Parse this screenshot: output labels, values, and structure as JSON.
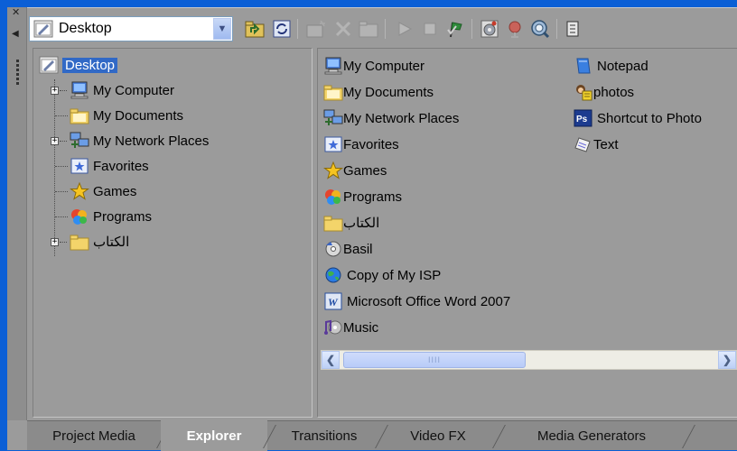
{
  "location": {
    "value": "Desktop"
  },
  "toolbar": {
    "buttons": [
      "up-folder",
      "refresh",
      "new-folder",
      "delete",
      "folder",
      "play",
      "stop",
      "auto-preview",
      "media-info",
      "record",
      "views",
      "more"
    ]
  },
  "tree": {
    "root": "Desktop",
    "items": [
      "My Computer",
      "My Documents",
      "My Network Places",
      "Favorites",
      "Games",
      "Programs",
      "الكتاب"
    ]
  },
  "list": {
    "col1": [
      "My Computer",
      "My Documents",
      "My Network Places",
      "Favorites",
      "Games",
      "Programs",
      "الكتاب",
      "Basil",
      "Copy of My ISP",
      "Microsoft Office Word 2007",
      "Music"
    ],
    "col2": [
      "Notepad",
      "photos",
      "Shortcut to Photo",
      "Text"
    ]
  },
  "scrollbar": {
    "grip": "IIII"
  },
  "tabs": [
    "Project Media",
    "Explorer",
    "Transitions",
    "Video FX",
    "Media Generators"
  ],
  "active_tab": "Explorer",
  "colors": {
    "desktop_blue": "#0b5fd6",
    "selection": "#3169c6",
    "panel": "#9b9b9b"
  }
}
